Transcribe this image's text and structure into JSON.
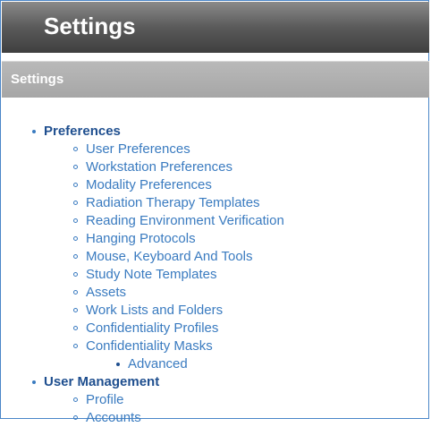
{
  "header": {
    "title": "Settings"
  },
  "subheader": {
    "title": "Settings"
  },
  "menu": {
    "preferences": {
      "label": "Preferences",
      "items": [
        "User Preferences",
        "Workstation Preferences",
        "Modality Preferences",
        "Radiation Therapy Templates",
        "Reading Environment Verification",
        "Hanging Protocols",
        "Mouse, Keyboard And Tools",
        "Study Note Templates",
        "Assets",
        "Work Lists and Folders",
        "Confidentiality Profiles",
        "Confidentiality Masks"
      ],
      "advanced": "Advanced"
    },
    "user_management": {
      "label": "User Management",
      "items": [
        "Profile",
        "Accounts"
      ]
    }
  },
  "colors": {
    "header_bg": "#5a5a5a",
    "subheader_bg": "#a6a6a6",
    "link": "#3a7bc0",
    "link_bold": "#1f4f8f"
  }
}
